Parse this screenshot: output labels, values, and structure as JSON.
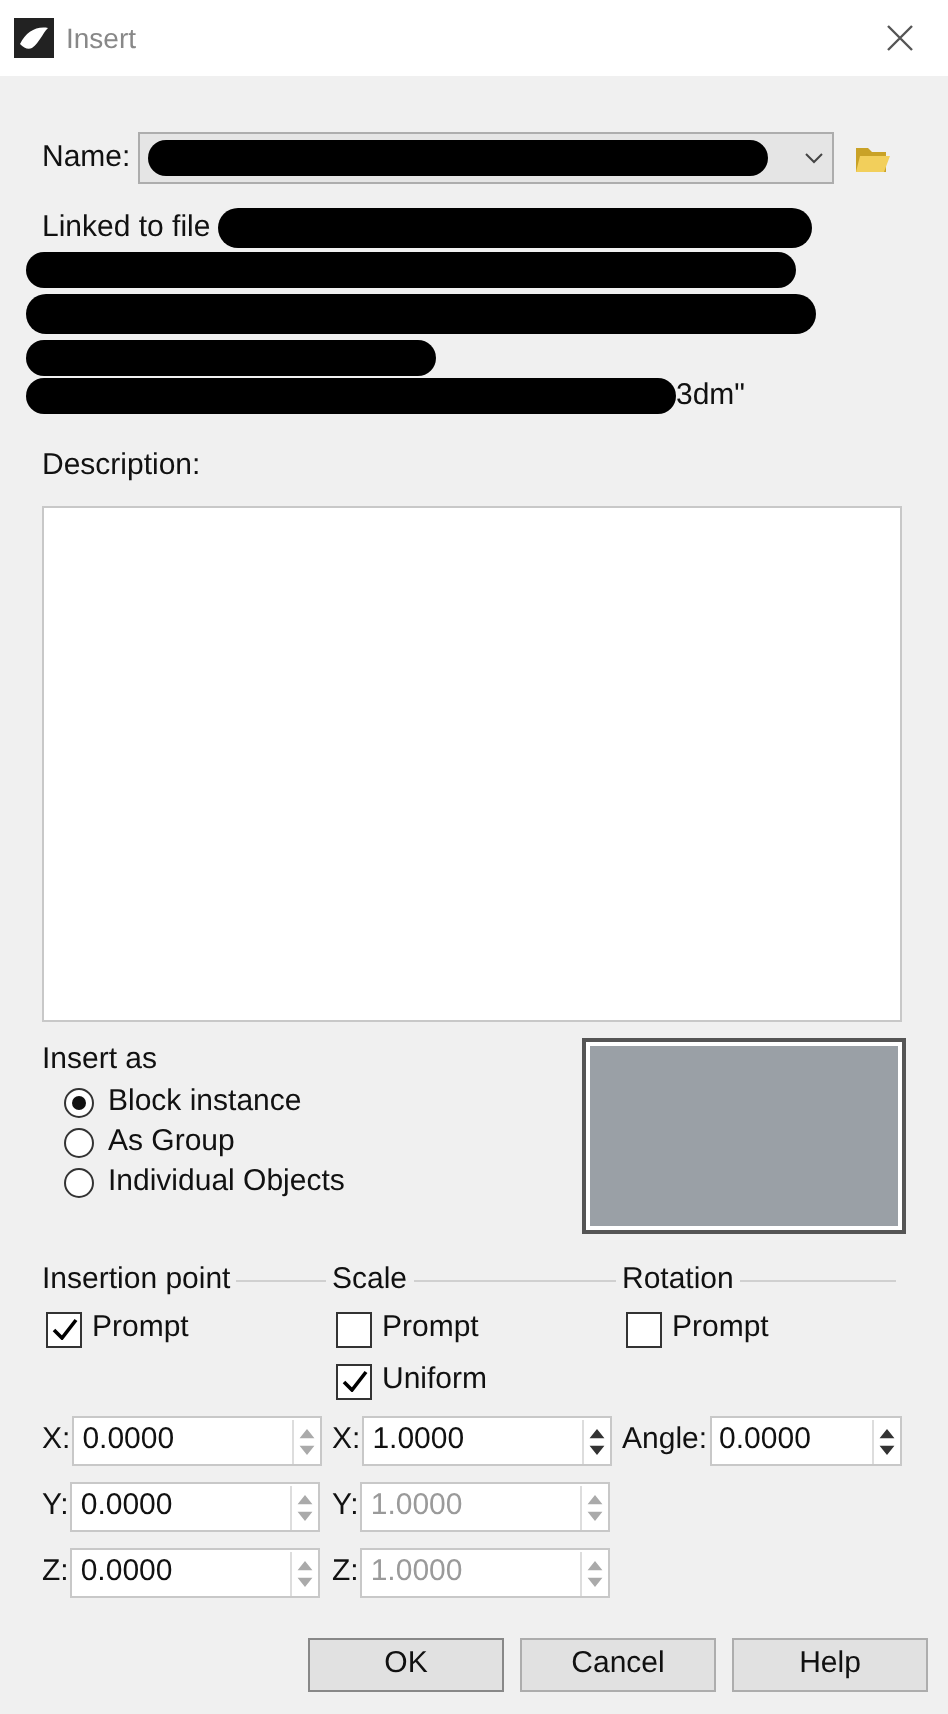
{
  "window": {
    "title": "Insert"
  },
  "name_field": {
    "label": "Name:"
  },
  "linked_file": {
    "label": "Linked to file",
    "visible_tail": "3dm\""
  },
  "description": {
    "label": "Description:"
  },
  "insert_as": {
    "label": "Insert as",
    "options": [
      {
        "label": "Block instance",
        "selected": true
      },
      {
        "label": "As Group",
        "selected": false
      },
      {
        "label": "Individual Objects",
        "selected": false
      }
    ]
  },
  "groups": [
    {
      "title": "Insertion point",
      "checks": [
        {
          "label": "Prompt",
          "checked": true
        }
      ],
      "fields": [
        {
          "label": "X:",
          "value": "0.0000",
          "disabled": false,
          "spinner_enabled": false
        },
        {
          "label": "Y:",
          "value": "0.0000",
          "disabled": false,
          "spinner_enabled": false
        },
        {
          "label": "Z:",
          "value": "0.0000",
          "disabled": false,
          "spinner_enabled": false
        }
      ]
    },
    {
      "title": "Scale",
      "checks": [
        {
          "label": "Prompt",
          "checked": false
        },
        {
          "label": "Uniform",
          "checked": true
        }
      ],
      "fields": [
        {
          "label": "X:",
          "value": "1.0000",
          "disabled": false,
          "spinner_enabled": true
        },
        {
          "label": "Y:",
          "value": "1.0000",
          "disabled": true,
          "spinner_enabled": false
        },
        {
          "label": "Z:",
          "value": "1.0000",
          "disabled": true,
          "spinner_enabled": false
        }
      ]
    },
    {
      "title": "Rotation",
      "checks": [
        {
          "label": "Prompt",
          "checked": false
        }
      ],
      "fields": [
        {
          "label": "Angle:",
          "value": "0.0000",
          "disabled": false,
          "spinner_enabled": true
        }
      ]
    }
  ],
  "buttons": [
    "OK",
    "Cancel",
    "Help"
  ]
}
